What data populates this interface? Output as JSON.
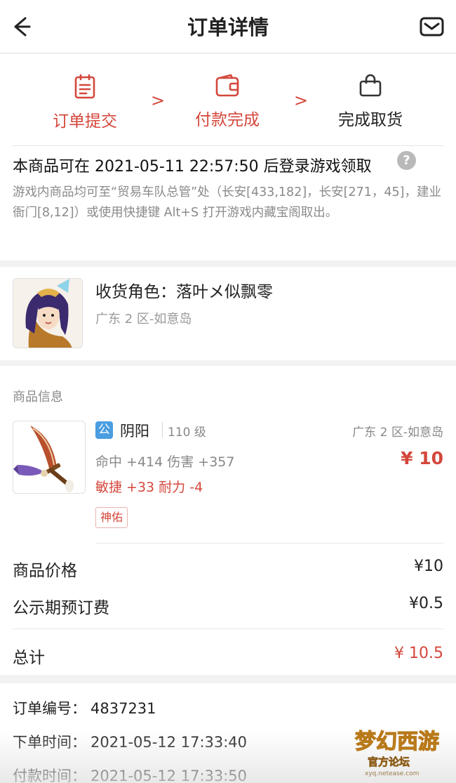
{
  "header": {
    "title": "订单详情",
    "back_icon": "arrow-left-icon",
    "mail_icon": "mail-icon"
  },
  "steps": [
    {
      "label": "订单提交",
      "icon": "clipboard-icon",
      "state": "done"
    },
    {
      "label": "付款完成",
      "icon": "wallet-icon",
      "state": "done"
    },
    {
      "label": "完成取货",
      "icon": "bag-icon",
      "state": "pending"
    }
  ],
  "step_separator": ">",
  "notice": {
    "title": "本商品可在 2021-05-11 22:57:50 后登录游戏领取",
    "help": "?",
    "description": "游戏内商品均可至“贸易车队总管”处（长安[433,182]，长安[271，45]，建业衙门[8,12]）或使用快捷键 Alt+S 打开游戏内藏宝阁取出。"
  },
  "receiver": {
    "label": "收货角色：落叶メ似飘零",
    "server": "广东 2 区-如意岛"
  },
  "goods": {
    "heading": "商品信息",
    "item": {
      "badge": "公",
      "name": "阴阳",
      "level": "110 级",
      "server": "广东 2 区-如意岛",
      "stats_primary": "命中 +414 伤害 +357",
      "stats_secondary": "敏捷 +33 耐力 -4",
      "price": "¥ 10",
      "tag": "神佑"
    },
    "fees": [
      {
        "label": "商品价格",
        "value": "¥10"
      },
      {
        "label": "公示期预订费",
        "value": "¥0.5"
      }
    ],
    "total": {
      "label": "总计",
      "value": "¥ 10.5"
    }
  },
  "order": [
    {
      "label": "订单编号：",
      "value": "4837231"
    },
    {
      "label": "下单时间：",
      "value": "2021-05-12 17:33:40"
    },
    {
      "label": "付款时间：",
      "value": "2021-05-12 17:33:50"
    }
  ],
  "watermark": {
    "logo": "梦幻西游",
    "sub": "官方论坛",
    "url": "xyq.netease.com"
  },
  "colors": {
    "accent": "#d4473c",
    "badge_blue": "#4a9de0",
    "muted": "#888888"
  }
}
